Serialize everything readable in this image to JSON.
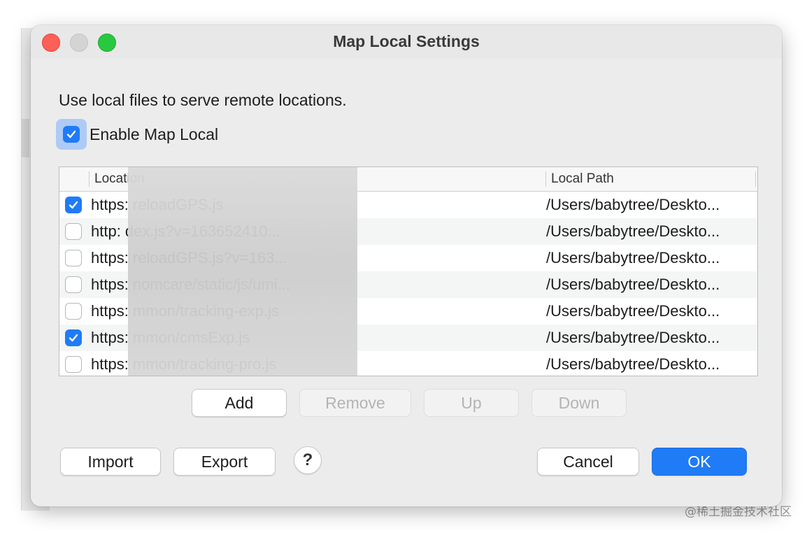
{
  "dialog": {
    "title": "Map Local Settings",
    "intro": "Use local files to serve remote locations.",
    "enable": {
      "label": "Enable Map Local",
      "checked": true
    }
  },
  "table": {
    "columns": [
      "Location",
      "Local Path"
    ],
    "rows": [
      {
        "checked": true,
        "location": "https:                                    reloadGPS.js",
        "local_path": "/Users/babytree/Deskto..."
      },
      {
        "checked": false,
        "location": "http:                                      dex.js?v=163652410...",
        "local_path": "/Users/babytree/Deskto..."
      },
      {
        "checked": false,
        "location": "https:                                    reloadGPS.js?v=163...",
        "local_path": "/Users/babytree/Deskto..."
      },
      {
        "checked": false,
        "location": "https:                                    nomcare/static/js/umi...",
        "local_path": "/Users/babytree/Deskto..."
      },
      {
        "checked": false,
        "location": "https:                                    mmon/tracking-exp.js",
        "local_path": "/Users/babytree/Deskto..."
      },
      {
        "checked": true,
        "location": "https:                                    mmon/cmsExp.js",
        "local_path": "/Users/babytree/Deskto..."
      },
      {
        "checked": false,
        "location": "https:                                    mmon/tracking-pro.js",
        "local_path": "/Users/babytree/Deskto..."
      }
    ]
  },
  "buttons": {
    "add": "Add",
    "remove": "Remove",
    "up": "Up",
    "down": "Down",
    "import": "Import",
    "export": "Export",
    "help": "?",
    "cancel": "Cancel",
    "ok": "OK"
  },
  "watermark": "@稀土掘金技术社区",
  "colors": {
    "accent": "#1f7bf6",
    "close": "#fe5f57",
    "minimize": "#d4d4d4",
    "maximize": "#28c840"
  }
}
